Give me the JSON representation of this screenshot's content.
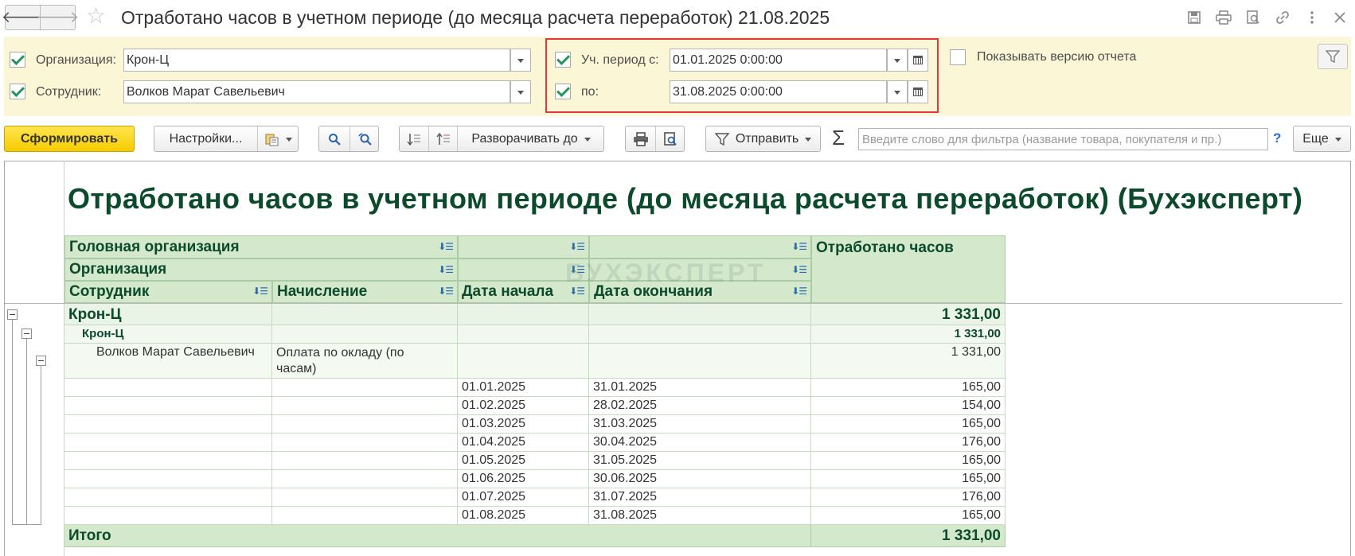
{
  "window": {
    "title": "Отработано часов в учетном периоде (до месяца расчета переработок) 21.08.2025",
    "back_symbol": "🡐",
    "forward_symbol": "🡒",
    "star_symbol": "☆",
    "icons": [
      "save-icon",
      "print-icon",
      "preview-icon",
      "link-icon",
      "more-icon",
      "close-icon"
    ]
  },
  "filters": {
    "organization": {
      "label": "Организация:",
      "value": "Крон-Ц",
      "checked": true
    },
    "employee": {
      "label": "Сотрудник:",
      "value": "Волков Марат Савельевич",
      "checked": true
    },
    "period_from": {
      "label": "Уч. период с:",
      "value": "01.01.2025  0:00:00",
      "checked": true
    },
    "period_to": {
      "label": "по:",
      "value": "31.08.2025  0:00:00",
      "checked": true
    },
    "show_version": {
      "label": "Показывать версию отчета",
      "checked": false
    }
  },
  "toolbar": {
    "generate_label": "Сформировать",
    "settings_label": "Настройки...",
    "expand_label": "Разворачивать до",
    "send_label": "Отправить",
    "sigma": "Σ",
    "filter_placeholder": "Введите слово для фильтра (название товара, покупателя и пр.)",
    "help": "?",
    "more_label": "Еще"
  },
  "report": {
    "title": "Отработано часов в учетном периоде (до месяца расчета переработок) (Бухэксперт)",
    "watermark": "БУХЭКСПЕРТ",
    "headers": {
      "head_org": "Головная организация",
      "org": "Организация",
      "employee": "Сотрудник",
      "accrual": "Начисление",
      "date_start": "Дата начала",
      "date_end": "Дата окончания",
      "hours": "Отработано часов"
    },
    "group1": {
      "name": "Крон-Ц",
      "hours": "1 331,00"
    },
    "group2": {
      "name": "Крон-Ц",
      "hours": "1 331,00"
    },
    "group3": {
      "employee": "Волков Марат Савельевич",
      "accrual_line1": "Оплата по окладу (по",
      "accrual_line2": "часам)",
      "hours": "1 331,00"
    },
    "rows": [
      {
        "start": "01.01.2025",
        "end": "31.01.2025",
        "hours": "165,00"
      },
      {
        "start": "01.02.2025",
        "end": "28.02.2025",
        "hours": "154,00"
      },
      {
        "start": "01.03.2025",
        "end": "31.03.2025",
        "hours": "165,00"
      },
      {
        "start": "01.04.2025",
        "end": "30.04.2025",
        "hours": "176,00"
      },
      {
        "start": "01.05.2025",
        "end": "31.05.2025",
        "hours": "165,00"
      },
      {
        "start": "01.06.2025",
        "end": "30.06.2025",
        "hours": "165,00"
      },
      {
        "start": "01.07.2025",
        "end": "31.07.2025",
        "hours": "176,00"
      },
      {
        "start": "01.08.2025",
        "end": "31.08.2025",
        "hours": "165,00"
      }
    ],
    "total": {
      "label": "Итого",
      "hours": "1 331,00"
    }
  }
}
